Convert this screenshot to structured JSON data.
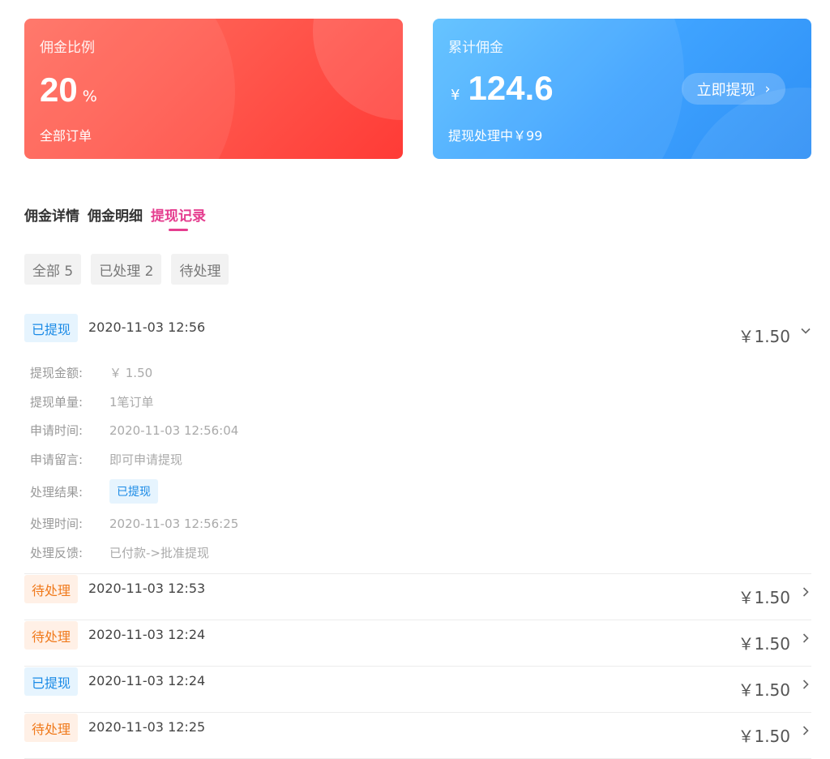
{
  "commission_card": {
    "label": "佣金比例",
    "rate": "20",
    "unit": "%",
    "footer": "全部订单",
    "colors": {
      "start": "#ff6f61",
      "end": "#ff3b36"
    }
  },
  "total_card": {
    "label": "累计佣金",
    "currency": "¥",
    "amount": "124.6",
    "footer": "提现处理中￥99",
    "button_label": "立即提现",
    "button_icon": "chevron-right-icon",
    "colors": {
      "start": "#5cc0ff",
      "end": "#2e8ff5"
    }
  },
  "tabs": [
    {
      "label": "佣金详情",
      "active": false
    },
    {
      "label": "佣金明细",
      "active": false
    },
    {
      "label": "提现记录",
      "active": true
    }
  ],
  "accent_color": "#e53d8f",
  "filters": [
    {
      "label": "全部 5"
    },
    {
      "label": "已处理 2"
    },
    {
      "label": "待处理"
    }
  ],
  "records": [
    {
      "status": "已提现",
      "status_type": "done",
      "time": "2020-11-03 12:56",
      "amount": "￥1.50",
      "expanded": true,
      "arrow_icon": "chevron-down-icon",
      "details": {
        "amount_label": "提现金额:",
        "amount_value": "￥ 1.50",
        "count_label": "提现单量:",
        "count_value": "1笔订单",
        "apply_time_label": "申请时间:",
        "apply_time_value": "2020-11-03 12:56:04",
        "message_label": "申请留言:",
        "message_value": "即可申请提现",
        "result_label": "处理结果:",
        "result_value": "已提现",
        "process_time_label": "处理时间:",
        "process_time_value": "2020-11-03 12:56:25",
        "feedback_label": "处理反馈:",
        "feedback_value": "已付款->批准提现"
      }
    },
    {
      "status": "待处理",
      "status_type": "pending",
      "time": "2020-11-03 12:53",
      "amount": "￥1.50",
      "expanded": false,
      "arrow_icon": "chevron-right-icon"
    },
    {
      "status": "待处理",
      "status_type": "pending",
      "time": "2020-11-03 12:24",
      "amount": "￥1.50",
      "expanded": false,
      "arrow_icon": "chevron-right-icon"
    },
    {
      "status": "已提现",
      "status_type": "done",
      "time": "2020-11-03 12:24",
      "amount": "￥1.50",
      "expanded": false,
      "arrow_icon": "chevron-right-icon"
    },
    {
      "status": "待处理",
      "status_type": "pending",
      "time": "2020-11-03 12:25",
      "amount": "￥1.50",
      "expanded": false,
      "arrow_icon": "chevron-right-icon"
    }
  ]
}
